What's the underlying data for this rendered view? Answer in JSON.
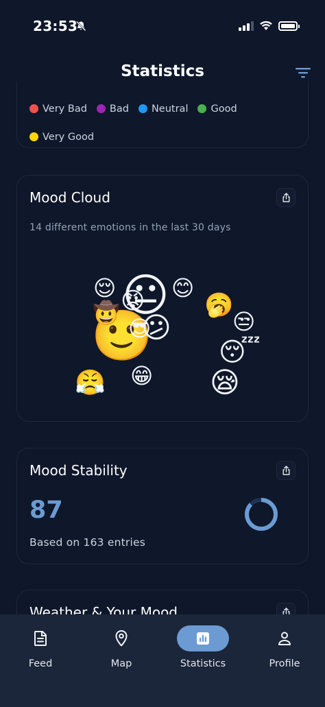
{
  "status_bar": {
    "time": "23:53"
  },
  "header": {
    "title": "Statistics",
    "filter_icon": "filter-icon"
  },
  "legend": {
    "items": [
      {
        "label": "Very Bad",
        "color": "#ef5350"
      },
      {
        "label": "Bad",
        "color": "#9c27b0"
      },
      {
        "label": "Neutral",
        "color": "#2196f3"
      },
      {
        "label": "Good",
        "color": "#4caf50"
      },
      {
        "label": "Very Good",
        "color": "#ffd600"
      }
    ]
  },
  "mood_cloud": {
    "title": "Mood Cloud",
    "subtitle": "14 different emotions in the last 30 days",
    "emojis": [
      "😐",
      "🙂",
      "😌",
      "😊",
      "😡",
      "🤠",
      "😎",
      "😕",
      "🥱",
      "😒",
      "😴",
      "😤",
      "😁",
      "😪"
    ]
  },
  "mood_stability": {
    "title": "Mood Stability",
    "value": "87",
    "subtitle": "Based on 163 entries",
    "score_fraction": 0.87
  },
  "weather": {
    "title": "Weather & Your Mood"
  },
  "tabs": [
    {
      "label": "Feed",
      "icon": "document-icon",
      "active": false
    },
    {
      "label": "Map",
      "icon": "map-pin-icon",
      "active": false
    },
    {
      "label": "Statistics",
      "icon": "bar-chart-icon",
      "active": true
    },
    {
      "label": "Profile",
      "icon": "person-icon",
      "active": false
    }
  ],
  "colors": {
    "accent": "#6b9bd2",
    "background": "#0f172a",
    "tabbar": "#1b263a"
  }
}
